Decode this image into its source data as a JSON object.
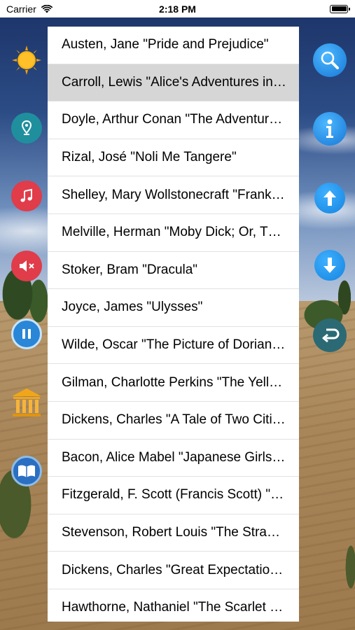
{
  "status_bar": {
    "carrier": "Carrier",
    "time": "2:18 PM"
  },
  "books": [
    "Austen, Jane \"Pride and Prejudice\"",
    "Carroll, Lewis \"Alice's Adventures in Wonderland\"",
    "Doyle, Arthur Conan \"The Adventures of Sherlock Holmes\"",
    "Rizal, José \"Noli Me Tangere\"",
    "Shelley, Mary Wollstonecraft \"Frankenstein\"",
    "Melville, Herman \"Moby Dick; Or, The Whale\"",
    "Stoker, Bram \"Dracula\"",
    "Joyce, James \"Ulysses\"",
    "Wilde, Oscar \"The Picture of Dorian Gray\"",
    "Gilman, Charlotte Perkins \"The Yellow Wallpaper\"",
    "Dickens, Charles \"A Tale of Two Cities\"",
    "Bacon, Alice Mabel \"Japanese Girls and Women\"",
    "Fitzgerald, F. Scott (Francis Scott) \"The Great Gatsby\"",
    "Stevenson, Robert Louis \"The Strange Case of Dr. Jekyll and Mr. Hyde\"",
    "Dickens, Charles \"Great Expectations\"",
    "Hawthorne, Nathaniel \"The Scarlet Letter\""
  ],
  "selected_index": 1,
  "left_buttons": [
    "sun-icon",
    "location-pin-icon",
    "music-note-icon",
    "mute-icon",
    "pause-icon",
    "museum-icon",
    "book-icon"
  ],
  "right_buttons": [
    "search-icon",
    "info-icon",
    "arrow-up-icon",
    "arrow-down-icon",
    "back-return-icon"
  ],
  "colors": {
    "teal": "#1f8f9e",
    "red": "#e03c4a",
    "blue": "#1a8fe0",
    "dark_teal": "#2b6a74",
    "selected_row": "#d6d6d6"
  }
}
